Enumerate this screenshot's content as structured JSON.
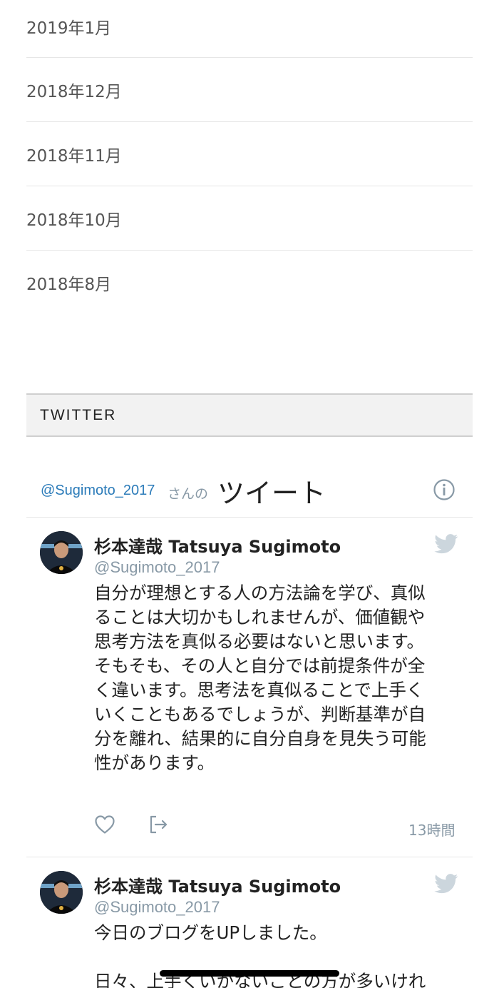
{
  "archives": [
    "2019年1月",
    "2018年12月",
    "2018年11月",
    "2018年10月",
    "2018年8月"
  ],
  "twitter_section": {
    "title": "TWITTER"
  },
  "timeline": {
    "handle_link": "@Sugimoto_2017",
    "san_no": "さんの",
    "title": "ツイート",
    "info_icon": "info-circle-icon"
  },
  "tweets": [
    {
      "author_name": "杉本達哉 Tatsuya Sugimoto",
      "author_handle": "@Sugimoto_2017",
      "text": "自分が理想とする人の方法論を学び、真似\nることは大切かもしれませんが、価値観や\n思考方法を真似る必要はないと思います。\nそもそも、その人と自分では前提条件が全\nく違います。思考法を真似ることで上手く\nいくこともあるでしょうが、判断基準が自\n分を離れ、結果的に自分自身を見失う可能\n性があります。",
      "timestamp": "13時間",
      "icons": [
        "heart-icon",
        "share-icon",
        "twitter-bird-icon"
      ]
    },
    {
      "author_name": "杉本達哉 Tatsuya Sugimoto",
      "author_handle": "@Sugimoto_2017",
      "text": "今日のブログをUPしました。",
      "text2": "日々、上手くいかないことの方が多いけれ",
      "icons": [
        "twitter-bird-icon"
      ]
    }
  ],
  "colors": {
    "link": "#2b7bb9",
    "muted": "#8899a6",
    "bird": "#ccd6dd"
  }
}
